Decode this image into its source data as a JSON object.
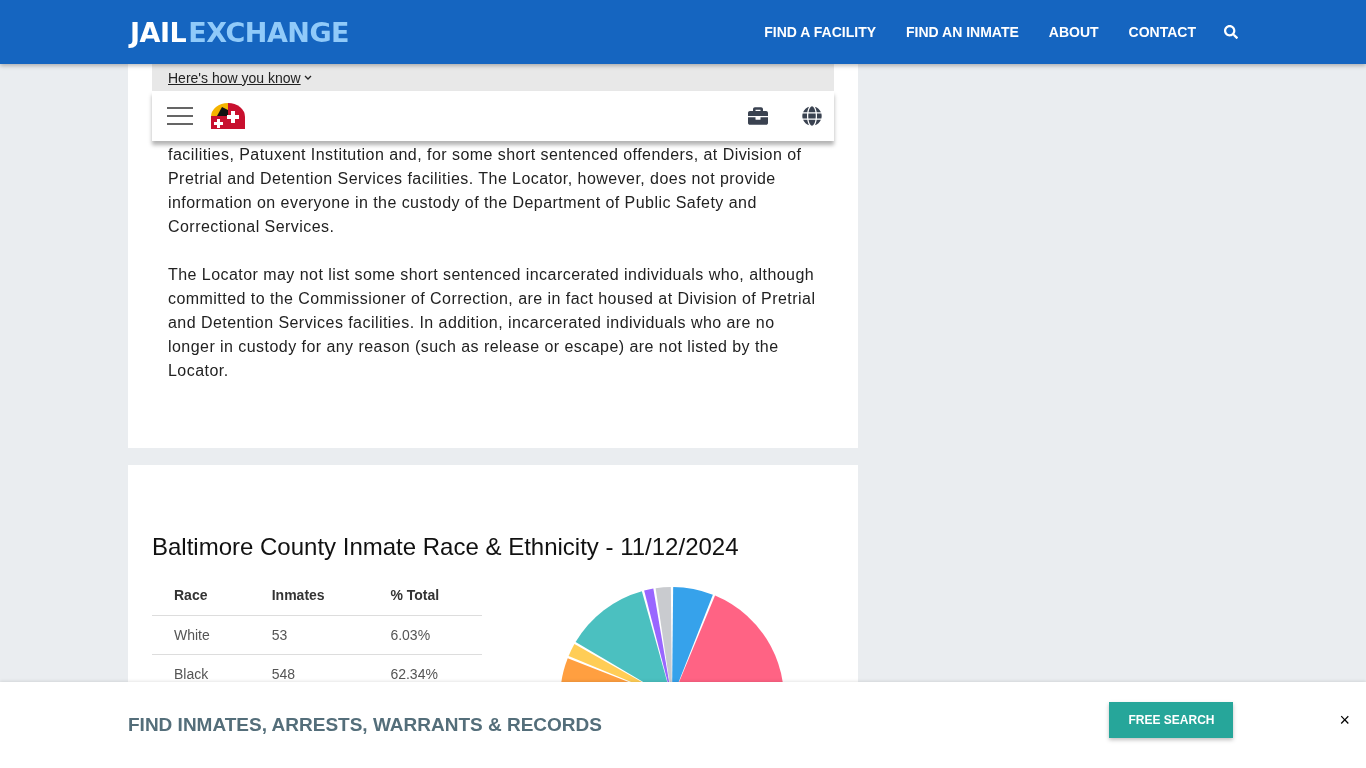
{
  "header": {
    "logo": {
      "part_1": "JAIL",
      "part_2": "EXCHANGE"
    },
    "nav": [
      "FIND A FACILITY",
      "FIND AN INMATE",
      "ABOUT",
      "CONTACT"
    ]
  },
  "gov_notice": {
    "link": "Here's how you know"
  },
  "article": {
    "paragraphs": [
      "facilities, Patuxent Institution and, for some short sentenced offenders, at Division of Pretrial and Detention Services facilities. The Locator, however, does not provide information on everyone in the custody of the Department of Public Safety and Correctional Services.",
      "The Locator may not list some short sentenced incarcerated individuals who, although committed to the Commissioner of Correction, are in fact housed at Division of Pretrial and Detention Services facilities. In addition, incarcerated individuals who are no longer in custody for any reason (such as release or escape) are not listed by the Locator."
    ]
  },
  "race_section": {
    "title": "Baltimore County Inmate Race & Ethnicity - 11/12/2024",
    "table": {
      "columns": [
        "Race",
        "Inmates",
        "% Total"
      ],
      "rows": [
        [
          "White",
          "53",
          "6.03%"
        ],
        [
          "Black",
          "548",
          "62.34%"
        ]
      ]
    }
  },
  "banner": {
    "text": "FIND INMATES, ARRESTS, WARRANTS & RECORDS",
    "button": "FREE SEARCH",
    "close": "×"
  }
}
